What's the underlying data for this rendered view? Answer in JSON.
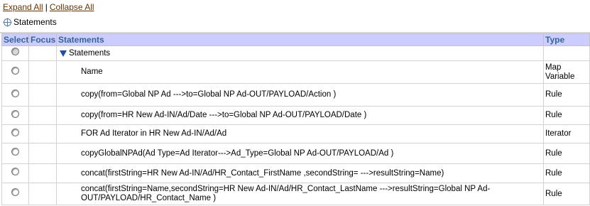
{
  "links": {
    "expand_all": "Expand All",
    "separator": "|",
    "collapse_all": "Collapse All"
  },
  "breadcrumb": {
    "label": "Statements"
  },
  "columns": {
    "select": "Select",
    "focus": "Focus",
    "statements": "Statements",
    "type": "Type"
  },
  "root_row": {
    "label": "Statements"
  },
  "rows": [
    {
      "statement": "Name",
      "type": "Map Variable"
    },
    {
      "statement": "copy(from=Global NP Ad --->to=Global NP Ad-OUT/PAYLOAD/Action )",
      "type": "Rule"
    },
    {
      "statement": "copy(from=HR New Ad-IN/Ad/Date --->to=Global NP Ad-OUT/PAYLOAD/Date )",
      "type": "Rule"
    },
    {
      "statement": "FOR Ad Iterator in HR New Ad-IN/Ad/Ad",
      "type": "Iterator"
    },
    {
      "statement": "copyGlobalNPAd(Ad Type=Ad Iterator--->Ad_Type=Global NP Ad-OUT/PAYLOAD/Ad )",
      "type": "Rule"
    },
    {
      "statement": "concat(firstString=HR New Ad-IN/Ad/HR_Contact_FirstName ,secondString= --->resultString=Name)",
      "type": "Rule"
    },
    {
      "statement": "concat(firstString=Name,secondString=HR New Ad-IN/Ad/HR_Contact_LastName --->resultString=Global NP Ad-OUT/PAYLOAD/HR_Contact_Name )",
      "type": "Rule"
    }
  ]
}
